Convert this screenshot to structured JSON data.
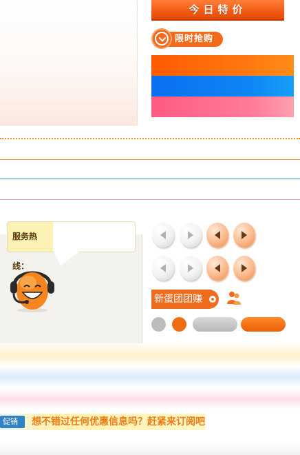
{
  "top": {
    "today_special": "今日特价",
    "flash_sale": "限时抢购"
  },
  "swatch_colors": {
    "orange": "#ff6a08",
    "blue": "#0f86f5",
    "pink": "#ff7b98"
  },
  "line_colors": {
    "dotted": "#f08a24",
    "orange": "#f28a30",
    "blue": "#2f8fd8",
    "pink": "#f3a2b6"
  },
  "service": {
    "hotline_label": "服务热线："
  },
  "arrows": [
    {
      "icon": "arrow-left-icon",
      "style": "gray"
    },
    {
      "icon": "arrow-right-icon",
      "style": "gray"
    },
    {
      "icon": "arrow-left-icon",
      "style": "orange"
    },
    {
      "icon": "arrow-right-icon",
      "style": "orange"
    }
  ],
  "group_buy": {
    "label": "新蛋团团赚",
    "icon": "people-icon"
  },
  "promo": {
    "tag": "促销",
    "text": "想不错过任何优惠信息吗？赶紧来订阅吧"
  }
}
